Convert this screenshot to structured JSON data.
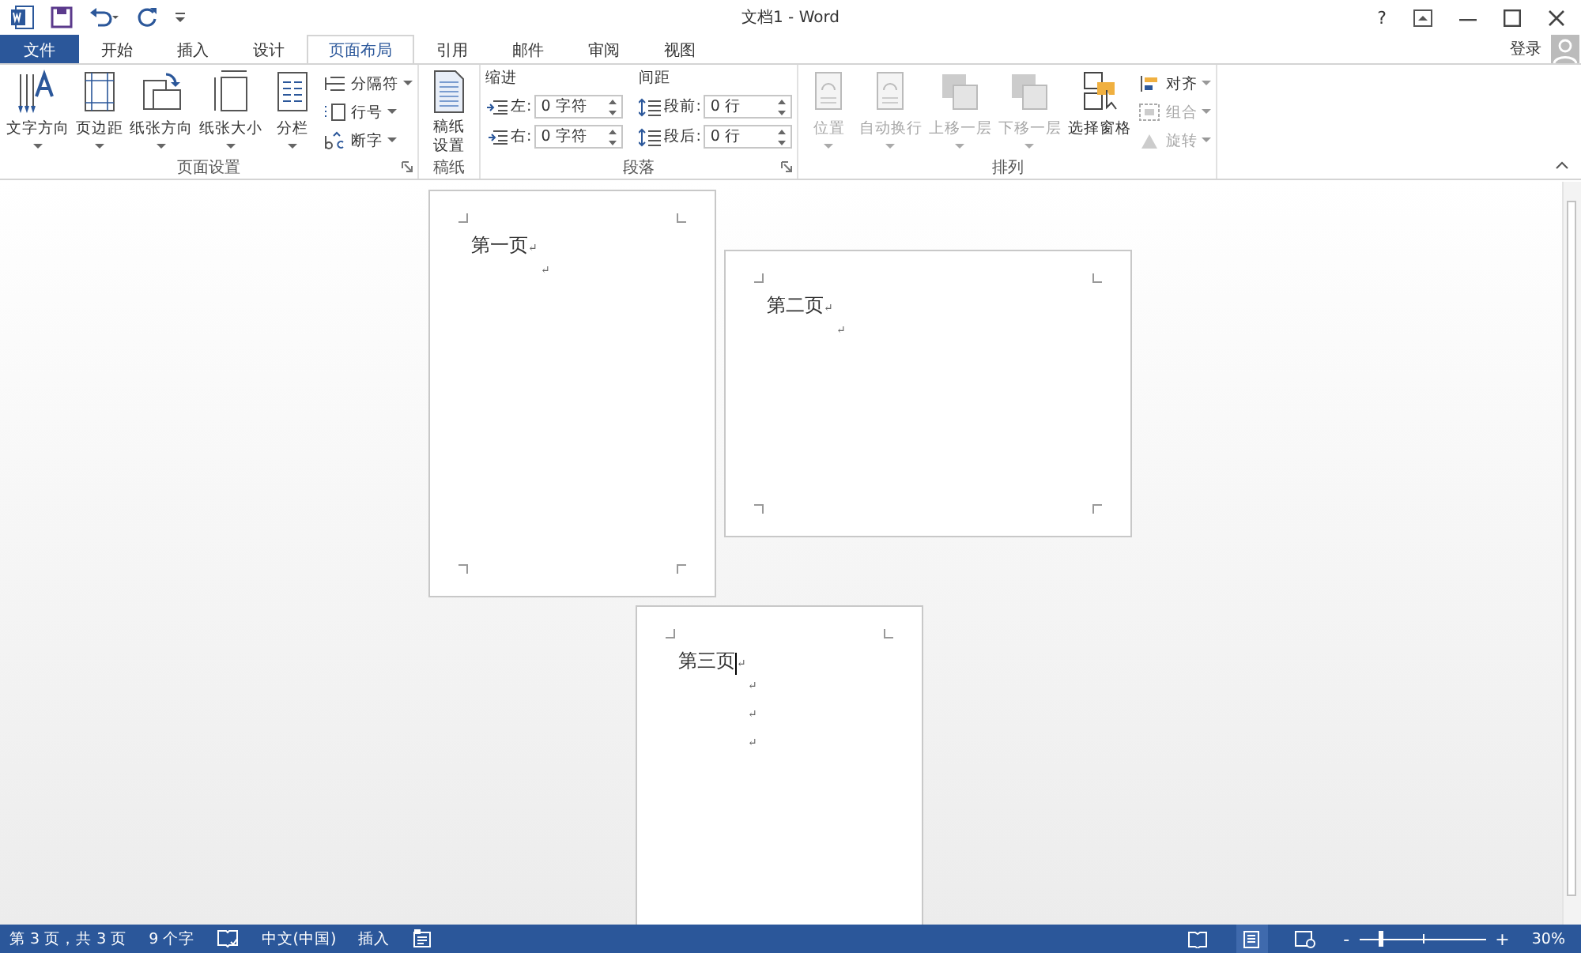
{
  "window": {
    "title": "文档1 - Word",
    "help": "?"
  },
  "tabs": [
    {
      "label": "文件",
      "kind": "file",
      "selected": false
    },
    {
      "label": "开始",
      "kind": "tab",
      "selected": false
    },
    {
      "label": "插入",
      "kind": "tab",
      "selected": false
    },
    {
      "label": "设计",
      "kind": "tab",
      "selected": false
    },
    {
      "label": "页面布局",
      "kind": "tab",
      "selected": true
    },
    {
      "label": "引用",
      "kind": "tab",
      "selected": false
    },
    {
      "label": "邮件",
      "kind": "tab",
      "selected": false
    },
    {
      "label": "审阅",
      "kind": "tab",
      "selected": false
    },
    {
      "label": "视图",
      "kind": "tab",
      "selected": false
    }
  ],
  "account": {
    "sign_in": "登录"
  },
  "ribbon": {
    "page_setup": {
      "label": "页面设置",
      "buttons": [
        {
          "label": "文字方向"
        },
        {
          "label": "页边距"
        },
        {
          "label": "纸张方向"
        },
        {
          "label": "纸张大小"
        },
        {
          "label": "分栏"
        }
      ],
      "small_buttons": [
        {
          "label": "分隔符"
        },
        {
          "label": "行号"
        },
        {
          "label": "断字"
        }
      ]
    },
    "manuscript": {
      "label": "稿纸",
      "button": "稿纸设置"
    },
    "paragraph": {
      "label": "段落",
      "indent_label": "缩进",
      "spacing_label": "间距",
      "indent": [
        {
          "label": "左:",
          "value": "0 字符"
        },
        {
          "label": "右:",
          "value": "0 字符"
        }
      ],
      "spacing": [
        {
          "label": "段前:",
          "value": "0 行"
        },
        {
          "label": "段后:",
          "value": "0 行"
        }
      ]
    },
    "arrange": {
      "label": "排列",
      "buttons": [
        {
          "label": "位置",
          "disabled": true
        },
        {
          "label": "自动换行",
          "disabled": true
        },
        {
          "label": "上移一层",
          "disabled": true
        },
        {
          "label": "下移一层",
          "disabled": true
        },
        {
          "label": "选择窗格",
          "disabled": false
        }
      ],
      "small_buttons": [
        {
          "label": "对齐",
          "disabled": false
        },
        {
          "label": "组合",
          "disabled": true
        },
        {
          "label": "旋转",
          "disabled": true
        }
      ]
    }
  },
  "pages": [
    {
      "lines": [
        {
          "text": "第一页",
          "mark": "↵",
          "cursor": false
        },
        {
          "mark": "↵",
          "cursor": false
        }
      ]
    },
    {
      "lines": [
        {
          "text": "第二页",
          "mark": "↵",
          "cursor": false
        },
        {
          "mark": "↵",
          "cursor": false
        }
      ]
    },
    {
      "lines": [
        {
          "text": "第三页",
          "mark": "↵",
          "cursor": true
        },
        {
          "mark": "↵",
          "cursor": false
        },
        {
          "mark": "↵",
          "cursor": false
        },
        {
          "mark": "↵",
          "cursor": false
        }
      ]
    }
  ],
  "status_bar": {
    "page": "第 3 页，共 3 页",
    "words": "9 个字",
    "language": "中文(中国)",
    "mode": "插入",
    "views": [
      {
        "selected": false
      },
      {
        "selected": true
      },
      {
        "selected": false
      }
    ],
    "zoom_out": "-",
    "zoom_in": "+",
    "zoom": {
      "level": 0.17
    },
    "zoom_reading": "30%"
  }
}
